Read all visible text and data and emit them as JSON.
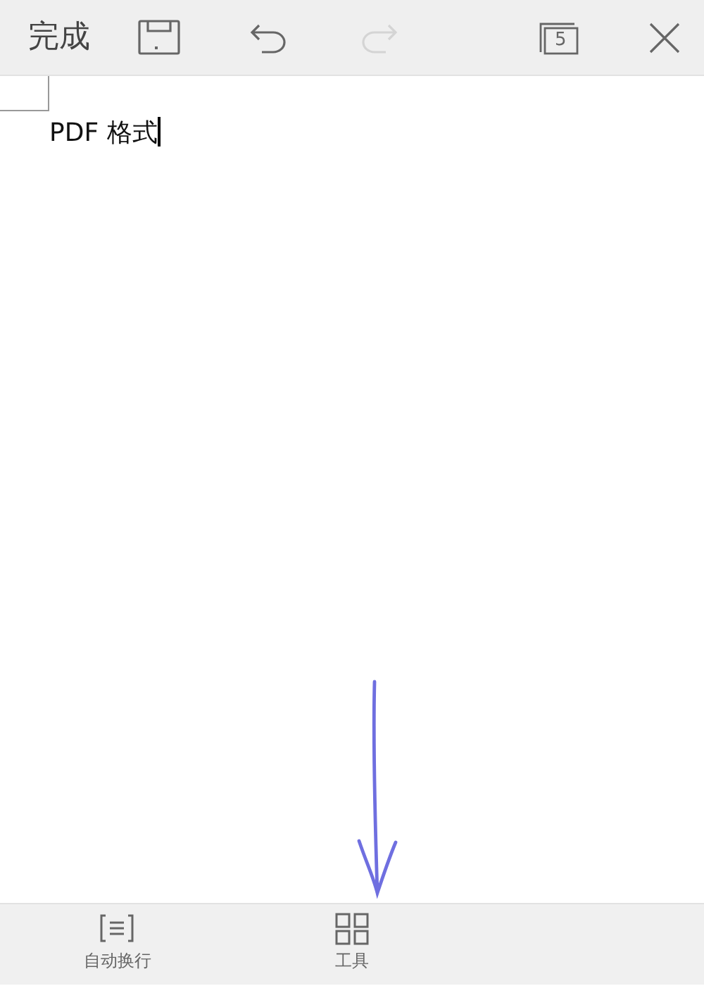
{
  "toolbar": {
    "done_label": "完成",
    "actions": [
      {
        "kind": "save",
        "disabled": false
      },
      {
        "kind": "undo",
        "disabled": false
      },
      {
        "kind": "redo",
        "disabled": true
      }
    ],
    "tab_count": "5"
  },
  "document": {
    "text": "PDF 格式",
    "cursor": true
  },
  "bottom_bar": [
    {
      "kind": "wrap",
      "label": "自动换行"
    },
    {
      "kind": "tools",
      "label": "工具"
    }
  ]
}
